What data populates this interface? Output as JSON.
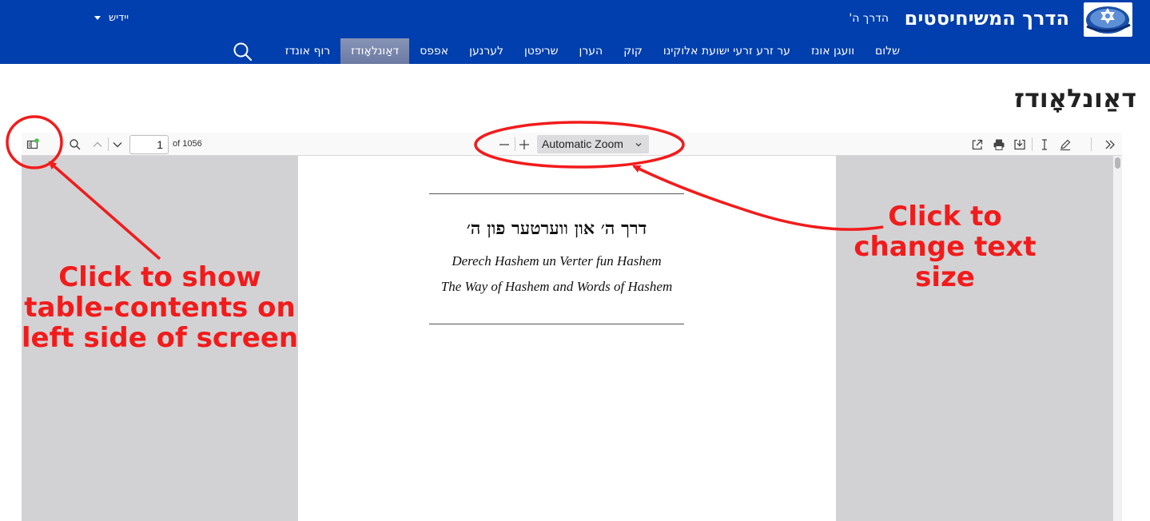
{
  "header": {
    "site_title": "הדרך המשיחיסטים",
    "site_subtitle": "הדרך ה'",
    "language": "יידיש",
    "nav": [
      {
        "label": "שלום",
        "active": false
      },
      {
        "label": "וועגן אונז",
        "active": false
      },
      {
        "label": "ער זרע זרעי ישועת אלוקינו",
        "active": false
      },
      {
        "label": "קוק",
        "active": false
      },
      {
        "label": "הערן",
        "active": false
      },
      {
        "label": "שריפטן",
        "active": false
      },
      {
        "label": "לערנען",
        "active": false
      },
      {
        "label": "אפפס",
        "active": false
      },
      {
        "label": "דאַונלאָודז",
        "active": true
      },
      {
        "label": "רוף אונדז",
        "active": false
      }
    ],
    "search_icon": "search-icon",
    "colors": {
      "header_bg": "#003fad",
      "active_tab": "#7b88ab"
    }
  },
  "page": {
    "title": "דאַונלאָודז"
  },
  "viewer": {
    "page_number": "1",
    "page_count": "of 1056",
    "zoom_label": "Automatic Zoom",
    "icons": [
      "sidebar-toggle-icon",
      "find-icon",
      "previous-page-icon",
      "next-page-icon",
      "zoom-out-icon",
      "zoom-in-icon",
      "open-file-icon",
      "print-icon",
      "download-icon",
      "text-select-icon",
      "draw-icon",
      "tools-menu-icon"
    ],
    "pdf": {
      "title": "דרך ה׳ און ווערטער פון ה׳",
      "line1": "Derech Hashem un Verter fun Hashem",
      "line2": "The Way of Hashem and Words of Hashem"
    }
  },
  "annotations": {
    "left_note": [
      "Click to show",
      "table-contents on",
      "left side of screen"
    ],
    "right_note": [
      "Click to",
      "change text",
      "size"
    ],
    "color": "#f21b1b"
  }
}
